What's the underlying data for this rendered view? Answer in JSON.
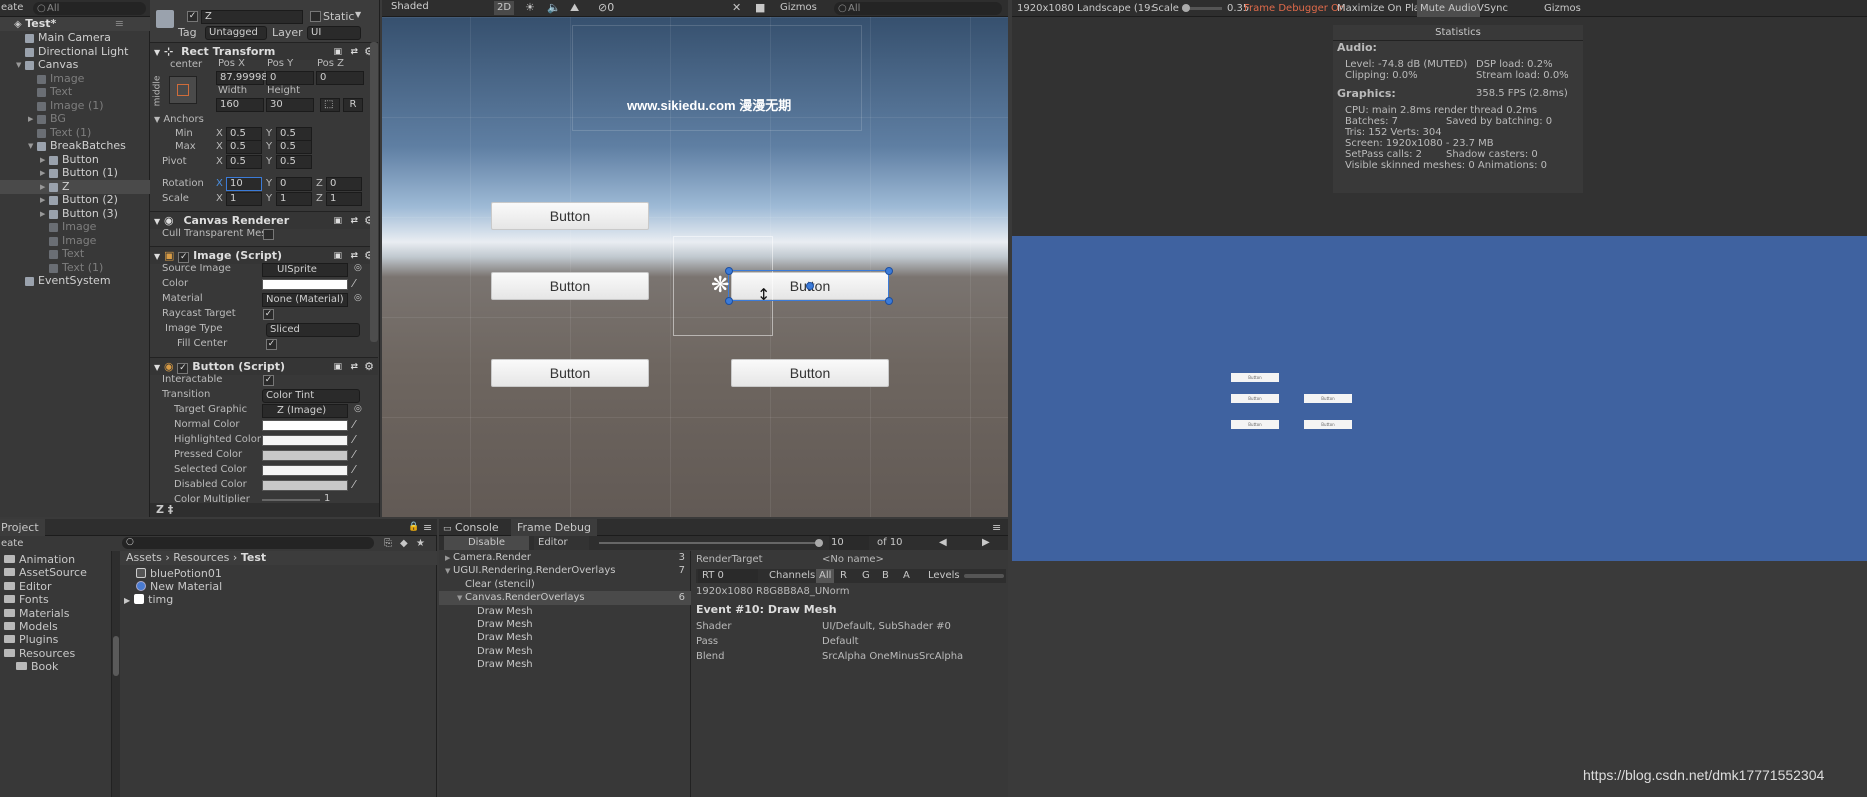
{
  "hierarchy": {
    "search": "All",
    "create": "eate",
    "scene": "Test*",
    "items": [
      {
        "label": "Main Camera",
        "indent": 1,
        "arrow": "",
        "dim": false,
        "sel": false
      },
      {
        "label": "Directional Light",
        "indent": 1,
        "arrow": "",
        "dim": false,
        "sel": false
      },
      {
        "label": "Canvas",
        "indent": 1,
        "arrow": "▼",
        "dim": false,
        "sel": false
      },
      {
        "label": "Image",
        "indent": 2,
        "arrow": "",
        "dim": true,
        "sel": false
      },
      {
        "label": "Text",
        "indent": 2,
        "arrow": "",
        "dim": true,
        "sel": false
      },
      {
        "label": "Image (1)",
        "indent": 2,
        "arrow": "",
        "dim": true,
        "sel": false
      },
      {
        "label": "BG",
        "indent": 2,
        "arrow": "▶",
        "dim": true,
        "sel": false
      },
      {
        "label": "Text (1)",
        "indent": 2,
        "arrow": "",
        "dim": true,
        "sel": false
      },
      {
        "label": "BreakBatches",
        "indent": 2,
        "arrow": "▼",
        "dim": false,
        "sel": false
      },
      {
        "label": "Button",
        "indent": 3,
        "arrow": "▶",
        "dim": false,
        "sel": false
      },
      {
        "label": "Button (1)",
        "indent": 3,
        "arrow": "▶",
        "dim": false,
        "sel": false
      },
      {
        "label": "Z",
        "indent": 3,
        "arrow": "▶",
        "dim": false,
        "sel": true
      },
      {
        "label": "Button (2)",
        "indent": 3,
        "arrow": "▶",
        "dim": false,
        "sel": false
      },
      {
        "label": "Button (3)",
        "indent": 3,
        "arrow": "▶",
        "dim": false,
        "sel": false
      },
      {
        "label": "Image",
        "indent": 3,
        "arrow": "",
        "dim": true,
        "sel": false
      },
      {
        "label": "Image",
        "indent": 3,
        "arrow": "",
        "dim": true,
        "sel": false
      },
      {
        "label": "Text",
        "indent": 3,
        "arrow": "",
        "dim": true,
        "sel": false
      },
      {
        "label": "Text (1)",
        "indent": 3,
        "arrow": "",
        "dim": true,
        "sel": false
      },
      {
        "label": "EventSystem",
        "indent": 1,
        "arrow": "",
        "dim": false,
        "sel": false
      }
    ]
  },
  "inspector": {
    "name": "Z",
    "static": "Static",
    "tag_label": "Tag",
    "tag": "Untagged",
    "layer_label": "Layer",
    "layer": "UI",
    "rect": {
      "title": "Rect Transform",
      "anchor_h": "center",
      "anchor_v": "middle",
      "posx_label": "Pos X",
      "posy_label": "Pos Y",
      "posz_label": "Pos Z",
      "posx": "87.99998",
      "posy": "0",
      "posz": "0",
      "width_label": "Width",
      "height_label": "Height",
      "width": "160",
      "height": "30",
      "r": "R",
      "anchors": "Anchors",
      "min": "Min",
      "max": "Max",
      "pivot": "Pivot",
      "x": "X",
      "y": "Y",
      "z": "Z",
      "min_x": "0.5",
      "min_y": "0.5",
      "max_x": "0.5",
      "max_y": "0.5",
      "pivot_x": "0.5",
      "pivot_y": "0.5",
      "rotation": "Rotation",
      "rot_x": "10",
      "rot_y": "0",
      "rot_z": "0",
      "scale": "Scale",
      "scale_x": "1",
      "scale_y": "1",
      "scale_z": "1"
    },
    "renderer": {
      "title": "Canvas Renderer",
      "cull": "Cull Transparent Mes"
    },
    "image": {
      "title": "Image (Script)",
      "source_label": "Source Image",
      "source": "UISprite",
      "color_label": "Color",
      "material_label": "Material",
      "material": "None (Material)",
      "raycast": "Raycast Target",
      "type_label": "Image Type",
      "type": "Sliced",
      "fill": "Fill Center"
    },
    "button": {
      "title": "Button (Script)",
      "interactable": "Interactable",
      "transition_label": "Transition",
      "transition": "Color Tint",
      "target_label": "Target Graphic",
      "target": "Z (Image)",
      "normal": "Normal Color",
      "highlighted": "Highlighted Color",
      "pressed": "Pressed Color",
      "selected": "Selected Color",
      "disabled": "Disabled Color",
      "multiplier": "Color Multiplier",
      "multiplier_value": "1"
    },
    "footer": "Z ‡"
  },
  "scene": {
    "shading": "Shaded",
    "mode2d": "2D",
    "fx_count": "0",
    "gizmos": "Gizmos",
    "search": "All",
    "watermark": "www.sikiedu.com 漫漫无期",
    "buttons": [
      "Button",
      "Button",
      "Button",
      "Button",
      "Button"
    ]
  },
  "game": {
    "resolution": "1920x1080 Landscape (19:",
    "scale_label": "Scale",
    "scale": "0.35",
    "frame_debugger": "Frame Debugger On",
    "maximize": "Maximize On Play",
    "mute": "Mute Audio",
    "vsync": "VSync",
    "stats": {
      "title": "Statistics",
      "audio": "Audio:",
      "level": "Level: -74.8 dB (MUTED)",
      "dsp": "DSP load: 0.2%",
      "clipping": "Clipping: 0.0%",
      "stream": "Stream load: 0.0%",
      "graphics": "Graphics:",
      "fps": "358.5 FPS (2.8ms)",
      "cpu": "CPU: main 2.8ms  render thread 0.2ms",
      "batches": "Batches: 7",
      "saved": "Saved by batching: 0",
      "tris": "Tris: 152  Verts: 304",
      "screen": "Screen: 1920x1080 - 23.7 MB",
      "setpass": "SetPass calls: 2",
      "shadow": "Shadow casters: 0",
      "skinned": "Visible skinned meshes: 0  Animations: 0"
    },
    "gizmos": "Gizmos",
    "mini_buttons": [
      "Button",
      "Button",
      "Button",
      "Button",
      "Button"
    ]
  },
  "project": {
    "tab": "Project",
    "create": "eate",
    "folders": [
      "Animation",
      "AssetSource",
      "Editor",
      "Fonts",
      "Materials",
      "Models",
      "Plugins",
      "Resources",
      "Book"
    ],
    "breadcrumb": [
      "Assets",
      "Resources",
      "Test"
    ],
    "assets": [
      "bluePotion01",
      "New Material",
      "timg"
    ]
  },
  "console_tab": "Console",
  "frame_debug": {
    "tab": "Frame Debug",
    "disable": "Disable",
    "editor": "Editor",
    "step": "10",
    "of": "of 10",
    "tree": [
      {
        "label": "Camera.Render",
        "count": "3",
        "indent": 0,
        "arrow": "▶",
        "sel": false
      },
      {
        "label": "UGUI.Rendering.RenderOverlays",
        "count": "7",
        "indent": 0,
        "arrow": "▼",
        "sel": false
      },
      {
        "label": "Clear (stencil)",
        "count": "",
        "indent": 1,
        "arrow": "",
        "sel": false
      },
      {
        "label": "Canvas.RenderOverlays",
        "count": "6",
        "indent": 1,
        "arrow": "▼",
        "sel": true
      },
      {
        "label": "Draw Mesh",
        "count": "",
        "indent": 2,
        "arrow": "",
        "sel": false
      },
      {
        "label": "Draw Mesh",
        "count": "",
        "indent": 2,
        "arrow": "",
        "sel": false
      },
      {
        "label": "Draw Mesh",
        "count": "",
        "indent": 2,
        "arrow": "",
        "sel": false
      },
      {
        "label": "Draw Mesh",
        "count": "",
        "indent": 2,
        "arrow": "",
        "sel": false
      },
      {
        "label": "Draw Mesh",
        "count": "",
        "indent": 2,
        "arrow": "",
        "sel": false
      }
    ],
    "rt_label": "RenderTarget",
    "rt_value": "<No name>",
    "rt0": "RT 0",
    "channels": "Channels",
    "ch": [
      "All",
      "R",
      "G",
      "B",
      "A"
    ],
    "levels": "Levels",
    "format": "1920x1080 R8G8B8A8_UNorm",
    "event": "Event #10: Draw Mesh",
    "props": [
      {
        "k": "Shader",
        "v": "UI/Default, SubShader #0"
      },
      {
        "k": "Pass",
        "v": "Default"
      },
      {
        "k": "Blend",
        "v": "SrcAlpha OneMinusSrcAlpha"
      }
    ]
  },
  "url_watermark": "https://blog.csdn.net/dmk17771552304"
}
